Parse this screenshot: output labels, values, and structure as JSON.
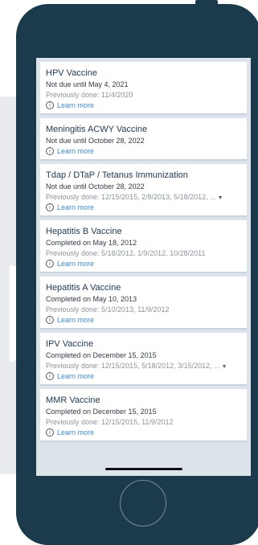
{
  "info_glyph": "i",
  "vaccines": [
    {
      "title": "HPV Vaccine",
      "status": "Not due until May 4, 2021",
      "previous": "Previously done: 11/4/2020",
      "learn": "Learn more",
      "expandable": false
    },
    {
      "title": "Meningitis ACWY Vaccine",
      "status": "Not due until October 28, 2022",
      "previous": "",
      "learn": "Learn more",
      "expandable": false
    },
    {
      "title": "Tdap / DTaP / Tetanus Immunization",
      "status": "Not due until October 28, 2022",
      "previous": "Previously done: 12/15/2015, 2/8/2013, 5/18/2012, ...",
      "learn": "Learn more",
      "expandable": true
    },
    {
      "title": "Hepatitis B Vaccine",
      "status": "Completed on May 18, 2012",
      "previous": "Previously done: 5/18/2012, 1/9/2012, 10/28/2011",
      "learn": "Learn more",
      "expandable": false
    },
    {
      "title": "Hepatitis A Vaccine",
      "status": "Completed on May 10, 2013",
      "previous": "Previously done: 5/10/2013, 11/9/2012",
      "learn": "Learn more",
      "expandable": false
    },
    {
      "title": "IPV Vaccine",
      "status": "Completed on December 15, 2015",
      "previous": "Previously done: 12/15/2015, 5/18/2012, 3/15/2012, ...",
      "learn": "Learn more",
      "expandable": true
    },
    {
      "title": "MMR Vaccine",
      "status": "Completed on December 15, 2015",
      "previous": "Previously done: 12/15/2015, 11/9/2012",
      "learn": "Learn more",
      "expandable": false
    }
  ]
}
